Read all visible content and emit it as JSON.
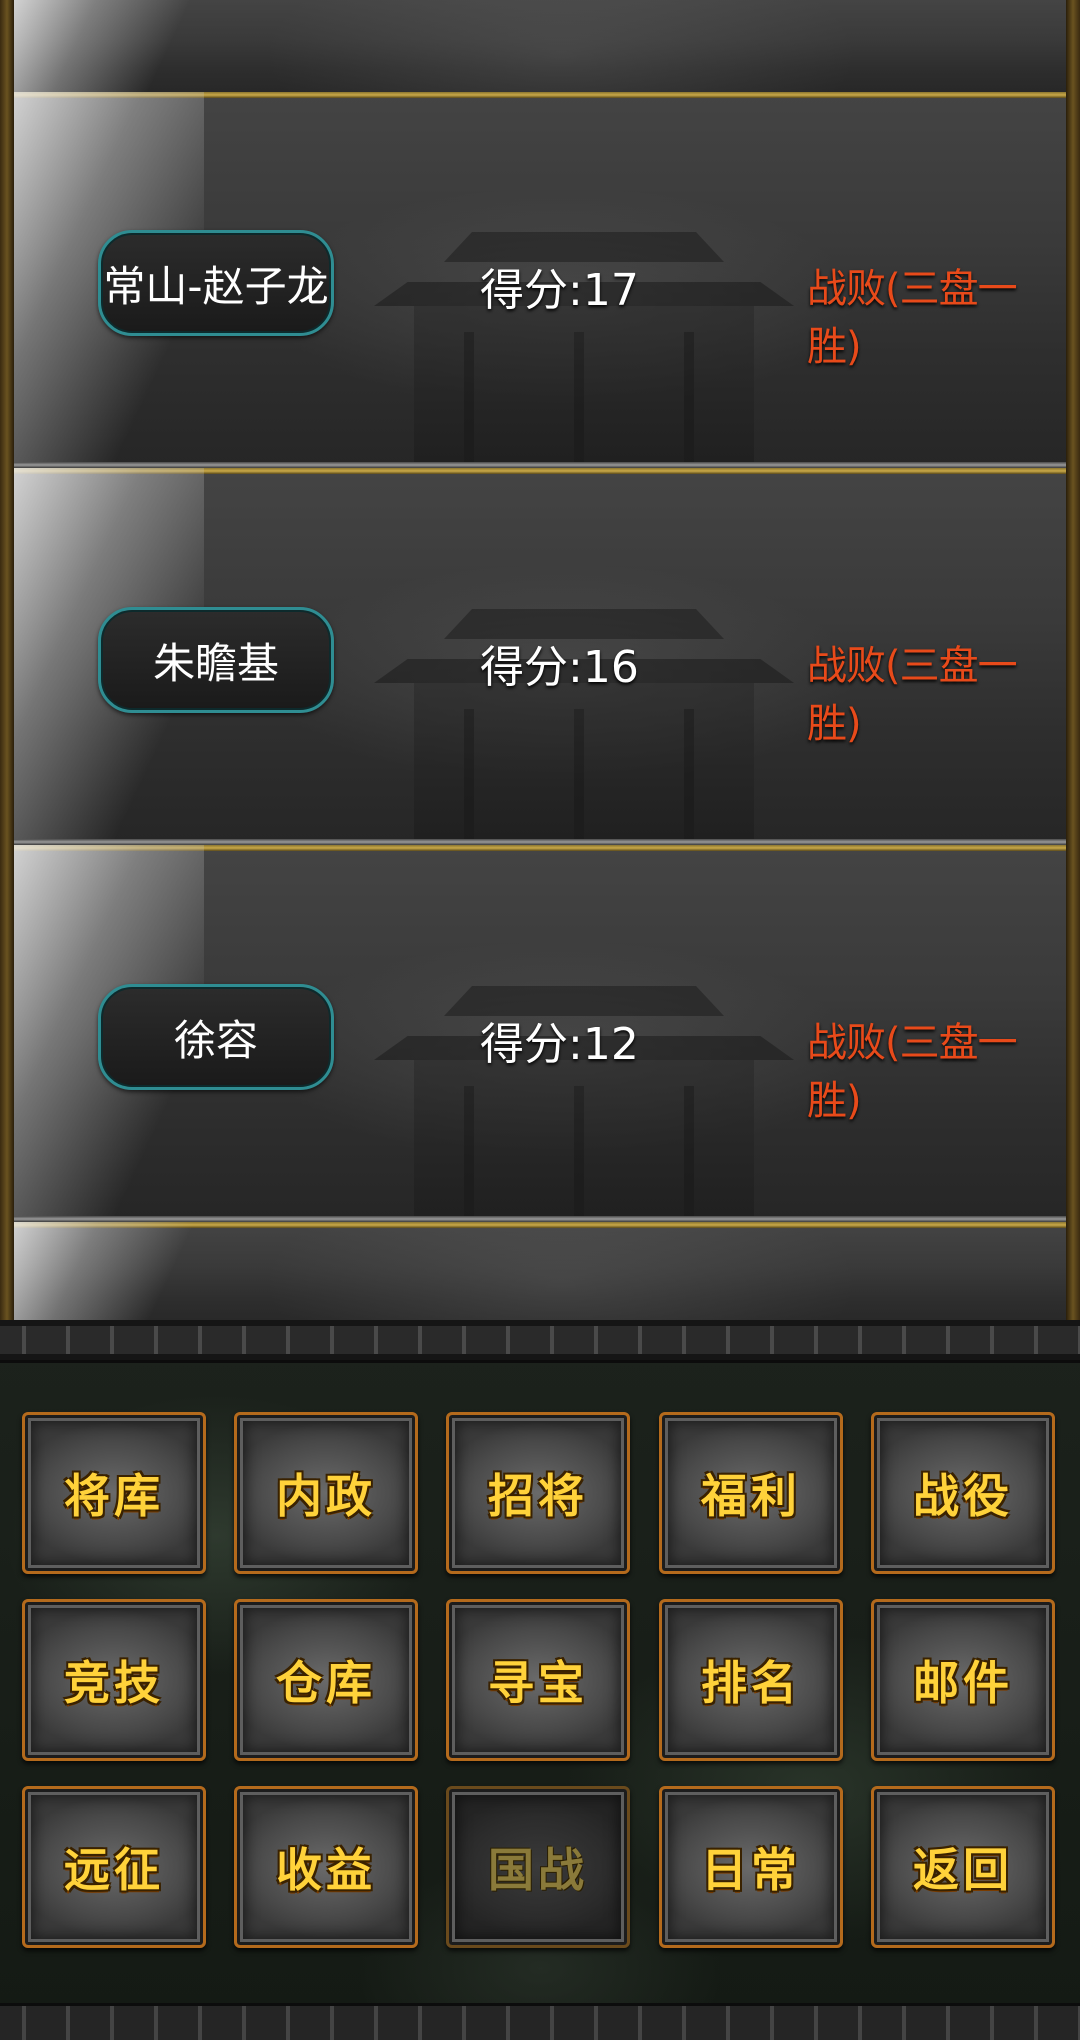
{
  "records": [
    {
      "name": "常山-赵子龙",
      "score": "得分:17",
      "result": "战败(三盘一胜)"
    },
    {
      "name": "朱瞻基",
      "score": "得分:16",
      "result": "战败(三盘一胜)"
    },
    {
      "name": "徐容",
      "score": "得分:12",
      "result": "战败(三盘一胜)"
    }
  ],
  "menu": {
    "row1": [
      "将库",
      "内政",
      "招将",
      "福利",
      "战役"
    ],
    "row2": [
      "竞技",
      "仓库",
      "寻宝",
      "排名",
      "邮件"
    ],
    "row3": [
      "远征",
      "收益",
      "国战",
      "日常",
      "返回"
    ],
    "disabled_item": "国战"
  },
  "colors": {
    "result_red": "#e84a1a",
    "menu_gold": "#ffd23a",
    "pill_border_teal": "#2f8d92",
    "button_border_orange": "#b46a1c"
  }
}
